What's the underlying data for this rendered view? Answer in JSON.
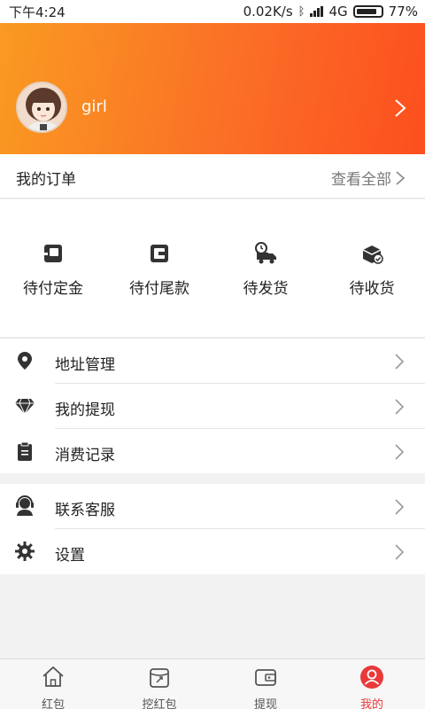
{
  "statusbar": {
    "time": "下午4:24",
    "speed": "0.02K/s",
    "network": "4G",
    "battery": "77%"
  },
  "profile": {
    "username": "girl"
  },
  "orders": {
    "title": "我的订单",
    "view_all": "查看全部",
    "items": [
      {
        "label": "待付定金",
        "icon": "wallet-icon"
      },
      {
        "label": "待付尾款",
        "icon": "wallet-card-icon"
      },
      {
        "label": "待发货",
        "icon": "delivery-truck-icon"
      },
      {
        "label": "待收货",
        "icon": "package-check-icon"
      }
    ]
  },
  "menu": [
    {
      "label": "地址管理",
      "icon": "location-pin-icon"
    },
    {
      "label": "我的提现",
      "icon": "diamond-icon"
    },
    {
      "label": "消费记录",
      "icon": "clipboard-icon"
    },
    {
      "label": "联系客服",
      "icon": "customer-service-icon"
    },
    {
      "label": "设置",
      "icon": "gear-icon"
    }
  ],
  "tabbar": {
    "items": [
      {
        "label": "红包",
        "icon": "home-icon"
      },
      {
        "label": "挖红包",
        "icon": "bag-icon"
      },
      {
        "label": "提现",
        "icon": "wallet-icon"
      },
      {
        "label": "我的",
        "icon": "user-icon"
      }
    ],
    "active_index": 3,
    "active_color": "#e83a3a"
  },
  "colors": {
    "header_gradient_start": "#f99a22",
    "header_gradient_end": "#fc4f1e"
  }
}
